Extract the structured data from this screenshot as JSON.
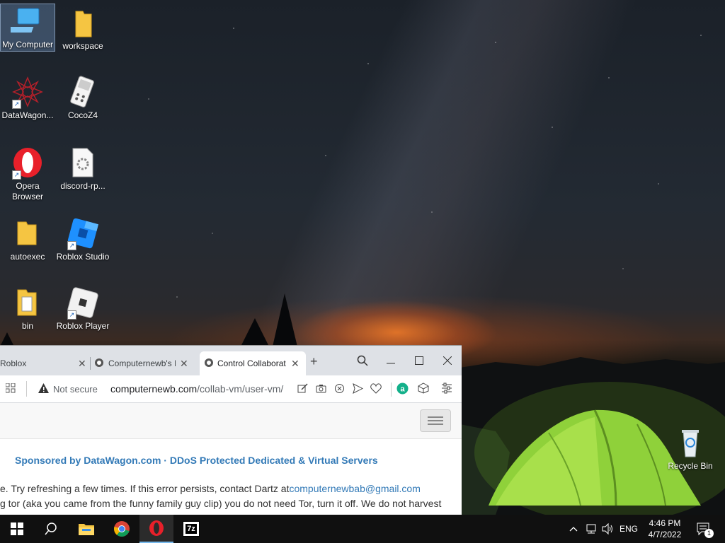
{
  "desktop": {
    "icons": [
      {
        "label": "My Computer",
        "icon": "computer-icon"
      },
      {
        "label": "workspace",
        "icon": "folder-icon"
      },
      {
        "label": "DataWagon...",
        "icon": "datawagon-icon"
      },
      {
        "label": "CocoZ4",
        "icon": "cocoz4-icon"
      },
      {
        "label": "Opera Browser",
        "icon": "opera-icon"
      },
      {
        "label": "discord-rp...",
        "icon": "settings-file-icon"
      },
      {
        "label": "autoexec",
        "icon": "folder-icon"
      },
      {
        "label": "Roblox Studio",
        "icon": "roblox-studio-icon"
      },
      {
        "label": "bin",
        "icon": "folder-icon"
      },
      {
        "label": "Roblox Player",
        "icon": "roblox-player-icon"
      },
      {
        "label": "Recycle Bin",
        "icon": "recycle-bin-icon"
      }
    ]
  },
  "browser": {
    "tabs": [
      {
        "title": "Roblox",
        "close": "✕"
      },
      {
        "title": "Computernewb's I",
        "close": "✕"
      },
      {
        "title": "Control Collaborat",
        "close": "✕"
      }
    ],
    "new_tab": "+",
    "security_label": "Not secure",
    "url_domain": "computernewb.com",
    "url_path": "/collab-vm/user-vm/",
    "sponsor_text": "Sponsored by DataWagon.com · DDoS Protected Dedicated & Virtual Servers",
    "error_line1": "e. Try refreshing a few times. If this error persists, contact Dartz at",
    "error_email": "computernewbab@gmail.com",
    "error_line2": "g tor (aka you came from the funny family guy clip) you do not need Tor, turn it off. We do not harvest"
  },
  "taskbar": {
    "pinned": [
      "windows-start-icon",
      "search-icon",
      "file-explorer-icon",
      "chrome-icon",
      "opera-icon",
      "7zip-icon"
    ],
    "sevenzip_label": "7z",
    "language": "ENG",
    "time": "4:46 PM",
    "date": "4/7/2022",
    "notification_count": "1"
  }
}
